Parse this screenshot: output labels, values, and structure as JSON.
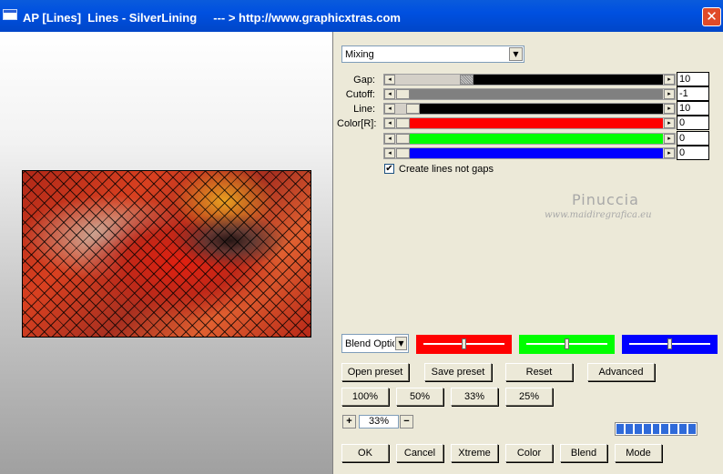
{
  "window": {
    "title": "AP [Lines]  Lines - SilverLining     --- > http://www.graphicxtras.com",
    "close_label": "✕"
  },
  "mode_dropdown": {
    "value": "Mixing"
  },
  "params": [
    {
      "label": "Gap:",
      "value": "10",
      "track_color": "#000000",
      "level": 0.25
    },
    {
      "label": "Cutoff:",
      "value": "-1",
      "track_color": "#808080",
      "level": 0.0
    },
    {
      "label": "Line:",
      "value": "10",
      "track_color": "#000000",
      "level": 0.04
    },
    {
      "label": "Color[R]:",
      "value": "0",
      "track_color": "#ff0000",
      "level": 0.0
    },
    {
      "label": "",
      "value": "0",
      "track_color": "#00ff00",
      "level": 0.0
    },
    {
      "label": "",
      "value": "0",
      "track_color": "#0000ff",
      "level": 0.0
    }
  ],
  "create_lines_not_gaps": {
    "checked": true,
    "label": "Create lines not gaps",
    "mark": "✔"
  },
  "watermark": {
    "name": "Pinuccia",
    "url": "www.maidiregrafica.eu"
  },
  "blend_options": {
    "value": "Blend Options"
  },
  "color_sliders": [
    {
      "color": "#ff0000",
      "level": 0.5
    },
    {
      "color": "#00ff00",
      "level": 0.5
    },
    {
      "color": "#0000ff",
      "level": 0.5
    }
  ],
  "preset_buttons": {
    "open": "Open preset",
    "save": "Save preset",
    "reset": "Reset",
    "advanced": "Advanced"
  },
  "zoom_buttons": {
    "z100": "100%",
    "z50": "50%",
    "z33": "33%",
    "z25": "25%"
  },
  "zoom": {
    "plus": "+",
    "value": "33%",
    "minus": "−"
  },
  "progress_segments": 9,
  "bottom_buttons": {
    "ok": "OK",
    "cancel": "Cancel",
    "xtreme": "Xtreme",
    "color": "Color",
    "blend": "Blend",
    "mode": "Mode"
  }
}
